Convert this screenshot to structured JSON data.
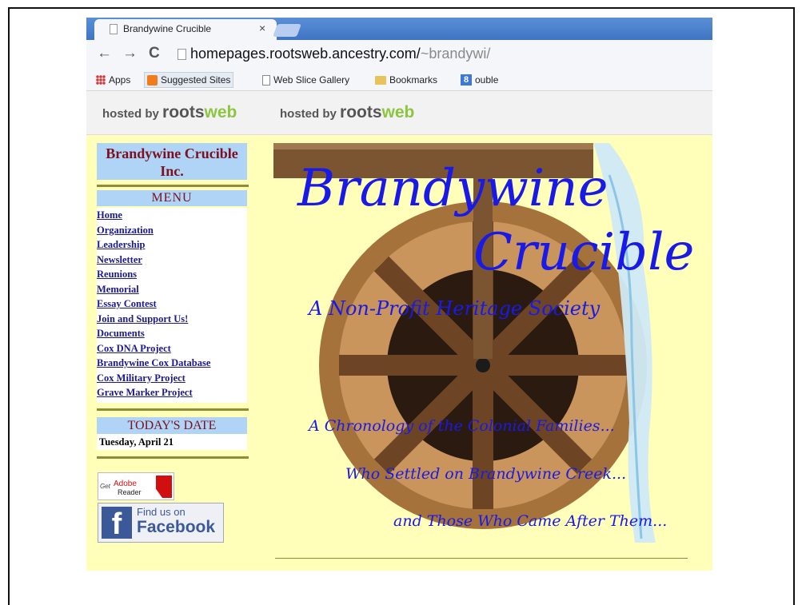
{
  "browser": {
    "tab_title": "Brandywine Crucible",
    "tab_close": "×",
    "url_host": "homepages.rootsweb.ancestry.com/",
    "url_path": "~brandywi/",
    "nav": {
      "back": "←",
      "forward": "→",
      "reload": "C"
    }
  },
  "bookmarks": [
    {
      "label": "Apps",
      "icon": "apps-icon"
    },
    {
      "label": "Suggested Sites",
      "icon": "suggested-sites-icon"
    },
    {
      "label": "Web Slice Gallery",
      "icon": "page-icon"
    },
    {
      "label": "Bookmarks",
      "icon": "folder-icon"
    },
    {
      "label": "ouble",
      "icon": "google-icon"
    }
  ],
  "host_banner": {
    "prefix": "hosted by",
    "brand_a": "roots",
    "brand_b": "web"
  },
  "sidebar": {
    "org_title": "Brandywine Crucible Inc.",
    "menu_heading": "MENU",
    "menu_items": [
      "Home",
      "Organization",
      "Leadership",
      "Newsletter",
      "Reunions",
      "Memorial",
      "Essay Contest",
      "Join and Support Us!",
      "Documents",
      "Cox DNA Project",
      "Brandywine Cox Database",
      "Cox Military Project",
      "Grave Marker Project"
    ],
    "date_heading": "TODAY'S DATE",
    "date_value": "Tuesday, April 21",
    "adobe": {
      "get": "Get",
      "brand": "Adobe",
      "product": "Reader"
    },
    "facebook": {
      "line1": "Find us on",
      "line2": "Facebook",
      "logo": "f"
    }
  },
  "hero": {
    "title_line1": "Brandywine",
    "title_line2": "Crucible",
    "tagline": "A Non-Profit Heritage Society",
    "line1": "A Chronology of the Colonial Families...",
    "line2": "Who Settled on Brandywine Creek...",
    "line3": "and Those Who Came After Them..."
  },
  "colors": {
    "page_bg": "#ffffb9",
    "panel_blue": "#b0d4f5",
    "heading_red": "#7a1020",
    "link": "#1a1a8c",
    "hero_text": "#1a1ae6",
    "rule": "#8d8d37"
  }
}
